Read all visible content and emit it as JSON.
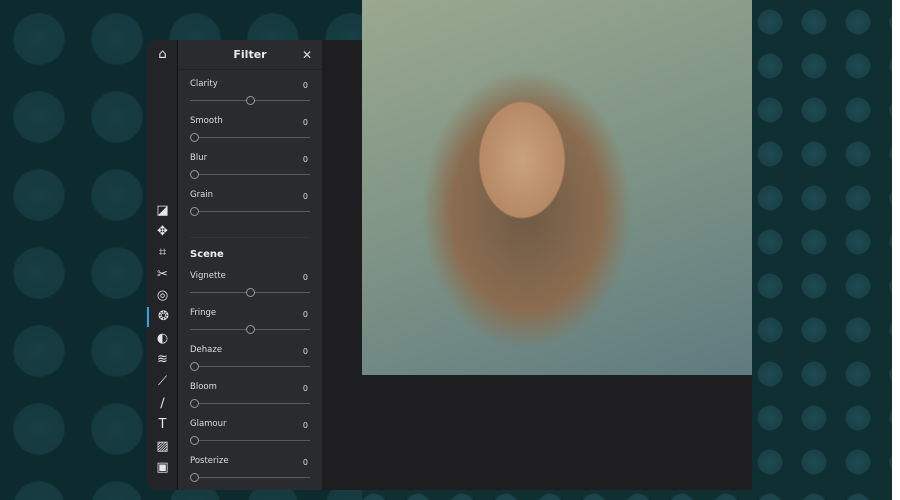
{
  "panel": {
    "title": "Filter",
    "close_icon": "close-icon"
  },
  "sliders_top": [
    {
      "label": "Clarity",
      "value": "0",
      "position": 0.5
    },
    {
      "label": "Smooth",
      "value": "0",
      "position": 0
    },
    {
      "label": "Blur",
      "value": "0",
      "position": 0
    },
    {
      "label": "Grain",
      "value": "0",
      "position": 0
    }
  ],
  "scene": {
    "title": "Scene"
  },
  "sliders_scene": [
    {
      "label": "Vignette",
      "value": "0",
      "position": 0.5
    },
    {
      "label": "Fringe",
      "value": "0",
      "position": 0.5
    },
    {
      "label": "Dehaze",
      "value": "0",
      "position": 0
    },
    {
      "label": "Bloom",
      "value": "0",
      "position": 0
    },
    {
      "label": "Glamour",
      "value": "0",
      "position": 0
    },
    {
      "label": "Posterize",
      "value": "0",
      "position": 0
    }
  ],
  "tools": [
    "home-icon",
    "adjust-icon",
    "move-icon",
    "crop-icon",
    "cut-icon",
    "exposure-icon",
    "filter-icon",
    "contrast-icon",
    "wave-icon",
    "dropper-icon",
    "brush-icon",
    "text-icon",
    "texture-icon",
    "image-icon"
  ],
  "accent": "#2aa6e0"
}
